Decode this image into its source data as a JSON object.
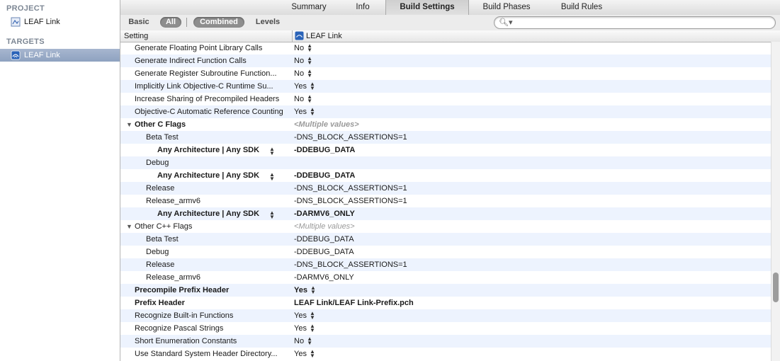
{
  "sidebar": {
    "project_header": "PROJECT",
    "project_item": "LEAF Link",
    "targets_header": "TARGETS",
    "target_item": "LEAF Link"
  },
  "tabs": [
    "Summary",
    "Info",
    "Build Settings",
    "Build Phases",
    "Build Rules"
  ],
  "active_tab": "Build Settings",
  "filter": {
    "basic": "Basic",
    "all": "All",
    "combined": "Combined",
    "levels": "Levels",
    "search_placeholder": ""
  },
  "columns": {
    "setting": "Setting",
    "target": "LEAF Link"
  },
  "rows": [
    {
      "name": "Generate Floating Point Library Calls",
      "value": "No",
      "stepper": true
    },
    {
      "name": "Generate Indirect Function Calls",
      "value": "No",
      "stepper": true
    },
    {
      "name": "Generate Register Subroutine Function...",
      "value": "No",
      "stepper": true
    },
    {
      "name": "Implicitly Link Objective-C Runtime Su...",
      "value": "Yes",
      "stepper": true
    },
    {
      "name": "Increase Sharing of Precompiled Headers",
      "value": "No",
      "stepper": true
    },
    {
      "name": "Objective-C Automatic Reference Counting",
      "value": "Yes",
      "stepper": true
    },
    {
      "name": "Other C Flags",
      "value": "<Multiple values>",
      "group": true,
      "bold": true
    },
    {
      "name": "Beta Test",
      "value": "-DNS_BLOCK_ASSERTIONS=1",
      "level": 1
    },
    {
      "name": "Any Architecture | Any SDK",
      "value": "-DDEBUG_DATA",
      "level": 2,
      "bold": true,
      "stepper_name": true
    },
    {
      "name": "Debug",
      "value": "",
      "level": 1
    },
    {
      "name": "Any Architecture | Any SDK",
      "value": "-DDEBUG_DATA",
      "level": 2,
      "bold": true,
      "stepper_name": true
    },
    {
      "name": "Release",
      "value": "-DNS_BLOCK_ASSERTIONS=1",
      "level": 1
    },
    {
      "name": "Release_armv6",
      "value": "-DNS_BLOCK_ASSERTIONS=1",
      "level": 1
    },
    {
      "name": "Any Architecture | Any SDK",
      "value": "-DARMV6_ONLY",
      "level": 2,
      "bold": true,
      "stepper_name": true
    },
    {
      "name": "Other C++ Flags",
      "value": "<Multiple values>",
      "group": true
    },
    {
      "name": "Beta Test",
      "value": "-DDEBUG_DATA",
      "level": 1
    },
    {
      "name": "Debug",
      "value": "-DDEBUG_DATA",
      "level": 1
    },
    {
      "name": "Release",
      "value": "-DNS_BLOCK_ASSERTIONS=1",
      "level": 1
    },
    {
      "name": "Release_armv6",
      "value": "-DARMV6_ONLY",
      "level": 1
    },
    {
      "name": "Precompile Prefix Header",
      "value": "Yes",
      "bold": true,
      "stepper": true
    },
    {
      "name": "Prefix Header",
      "value": "LEAF Link/LEAF Link-Prefix.pch",
      "bold": true
    },
    {
      "name": "Recognize Built-in Functions",
      "value": "Yes",
      "stepper": true
    },
    {
      "name": "Recognize Pascal Strings",
      "value": "Yes",
      "stepper": true
    },
    {
      "name": "Short Enumeration Constants",
      "value": "No",
      "stepper": true
    },
    {
      "name": "Use Standard System Header Directory...",
      "value": "Yes",
      "stepper": true
    }
  ]
}
